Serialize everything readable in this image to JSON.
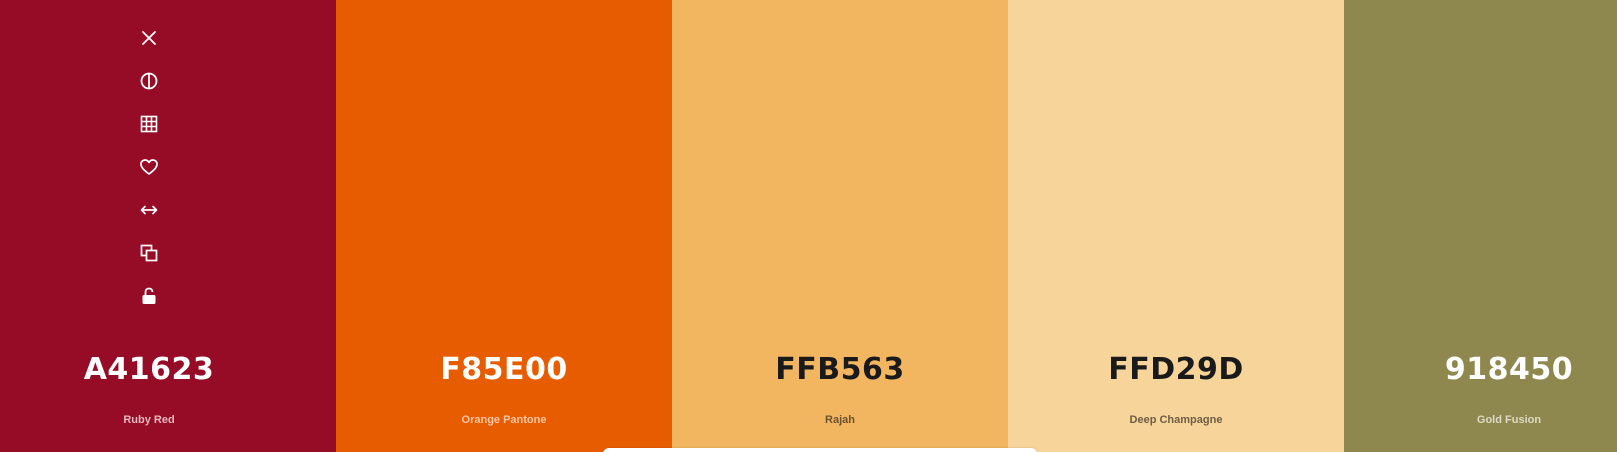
{
  "swatches": [
    {
      "hex": "A41623",
      "name": "Ruby Red",
      "bg": "#960b26",
      "text_color": "#ffffff",
      "name_color": "#e7b9c0"
    },
    {
      "hex": "F85E00",
      "name": "Orange Pantone",
      "bg": "#e85c00",
      "text_color": "#ffffff",
      "name_color": "#f9c7a4"
    },
    {
      "hex": "FFB563",
      "name": "Rajah",
      "bg": "#f2b660",
      "text_color": "#1a1a1a",
      "name_color": "#6b5230"
    },
    {
      "hex": "FFD29D",
      "name": "Deep Champagne",
      "bg": "#f7d49a",
      "text_color": "#1a1a1a",
      "name_color": "#6e5e45"
    },
    {
      "hex": "918450",
      "name": "Gold Fusion",
      "bg": "#8e874e",
      "text_color": "#ffffff",
      "name_color": "#dddac5"
    }
  ],
  "toolbar": {
    "icons": [
      "close-icon",
      "contrast-icon",
      "grid-icon",
      "heart-icon",
      "swap-horizontal-icon",
      "copy-icon",
      "unlock-icon"
    ]
  }
}
